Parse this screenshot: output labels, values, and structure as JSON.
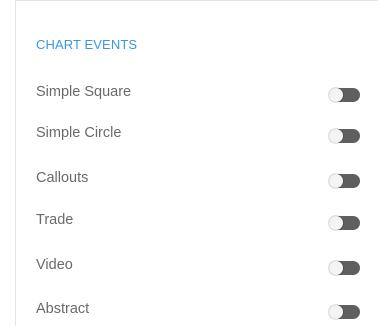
{
  "section": {
    "title": "CHART EVENTS"
  },
  "items": [
    {
      "label": "Simple Square",
      "enabled": false
    },
    {
      "label": "Simple Circle",
      "enabled": false
    },
    {
      "label": "Callouts",
      "enabled": false
    },
    {
      "label": "Trade",
      "enabled": false
    },
    {
      "label": "Video",
      "enabled": false
    },
    {
      "label": "Abstract",
      "enabled": false
    }
  ],
  "colors": {
    "accent": "#3b97e3",
    "label": "#6a6a6a",
    "toggle_track_off": "#5f5f5f",
    "toggle_knob": "#f4f4f4"
  }
}
